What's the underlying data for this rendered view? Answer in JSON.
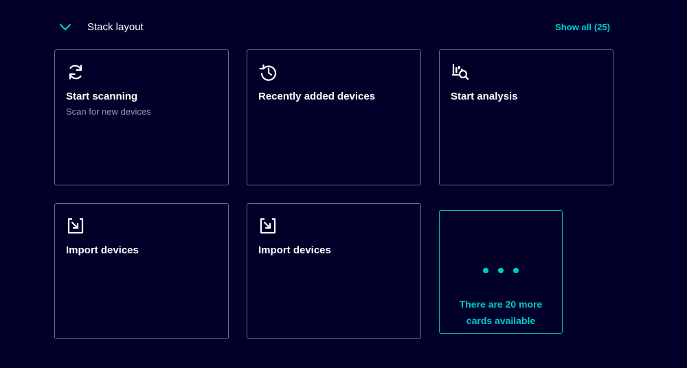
{
  "section": {
    "title": "Stack layout",
    "show_all_label": "Show all",
    "show_all_count": "(25)"
  },
  "cards": [
    {
      "title": "Start scanning",
      "subtitle": "Scan for new devices",
      "icon": "refresh-icon"
    },
    {
      "title": "Recently added devices",
      "subtitle": "",
      "icon": "history-icon"
    },
    {
      "title": "Start analysis",
      "subtitle": "",
      "icon": "analysis-icon"
    },
    {
      "title": "Import devices",
      "subtitle": "",
      "icon": "import-icon"
    },
    {
      "title": "Import devices",
      "subtitle": "",
      "icon": "import-icon"
    }
  ],
  "more_card": {
    "line1": "There are 20 more",
    "line2": "cards available"
  },
  "colors": {
    "background": "#000028",
    "accent": "#00cccc",
    "card_border": "#6e6e87",
    "subtitle": "#9999a9"
  }
}
